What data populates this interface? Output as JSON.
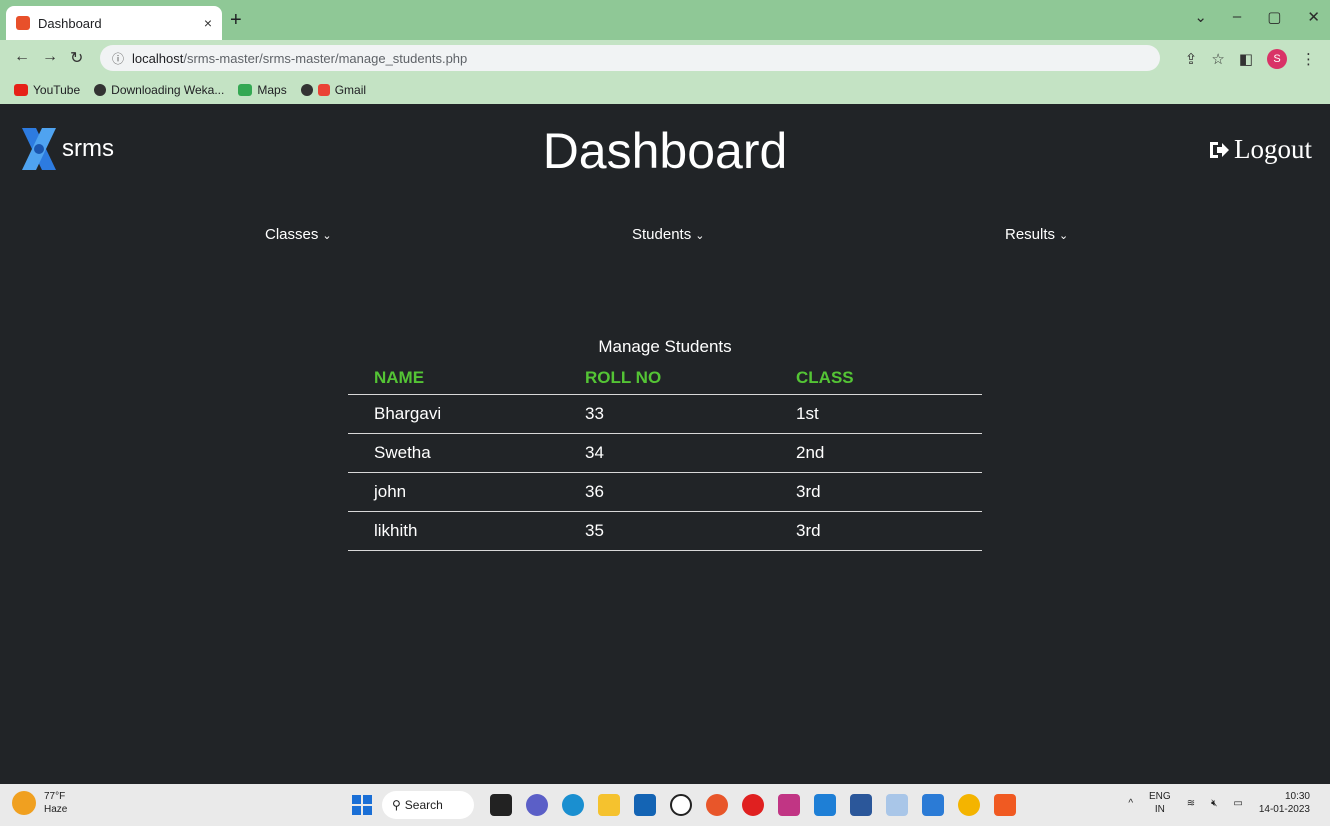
{
  "browser": {
    "tab_title": "Dashboard",
    "tab_close": "×",
    "new_tab": "+",
    "url_host": "localhost",
    "url_path": "/srms-master/srms-master/manage_students.php",
    "bookmarks": [
      "YouTube",
      "Downloading Weka...",
      "Maps",
      "Gmail"
    ]
  },
  "app": {
    "logo_text": "srms",
    "title": "Dashboard",
    "logout_label": "Logout",
    "menus": [
      "Classes",
      "Students",
      "Results"
    ]
  },
  "table": {
    "title": "Manage Students",
    "headers": [
      "NAME",
      "ROLL NO",
      "CLASS"
    ],
    "rows": [
      [
        "Bhargavi",
        "33",
        "1st"
      ],
      [
        "Swetha",
        "34",
        "2nd"
      ],
      [
        "john",
        "36",
        "3rd"
      ],
      [
        "likhith",
        "35",
        "3rd"
      ]
    ]
  },
  "taskbar": {
    "temp": "77°F",
    "weather": "Haze",
    "search_label": "Search",
    "lang_top": "ENG",
    "lang_bottom": "IN",
    "time": "10:30",
    "date": "14-01-2023"
  },
  "colors": {
    "page_bg": "#212427",
    "header_green": "#54c435",
    "tabbar": "#8fc896",
    "toolbar": "#c4e3c4"
  }
}
